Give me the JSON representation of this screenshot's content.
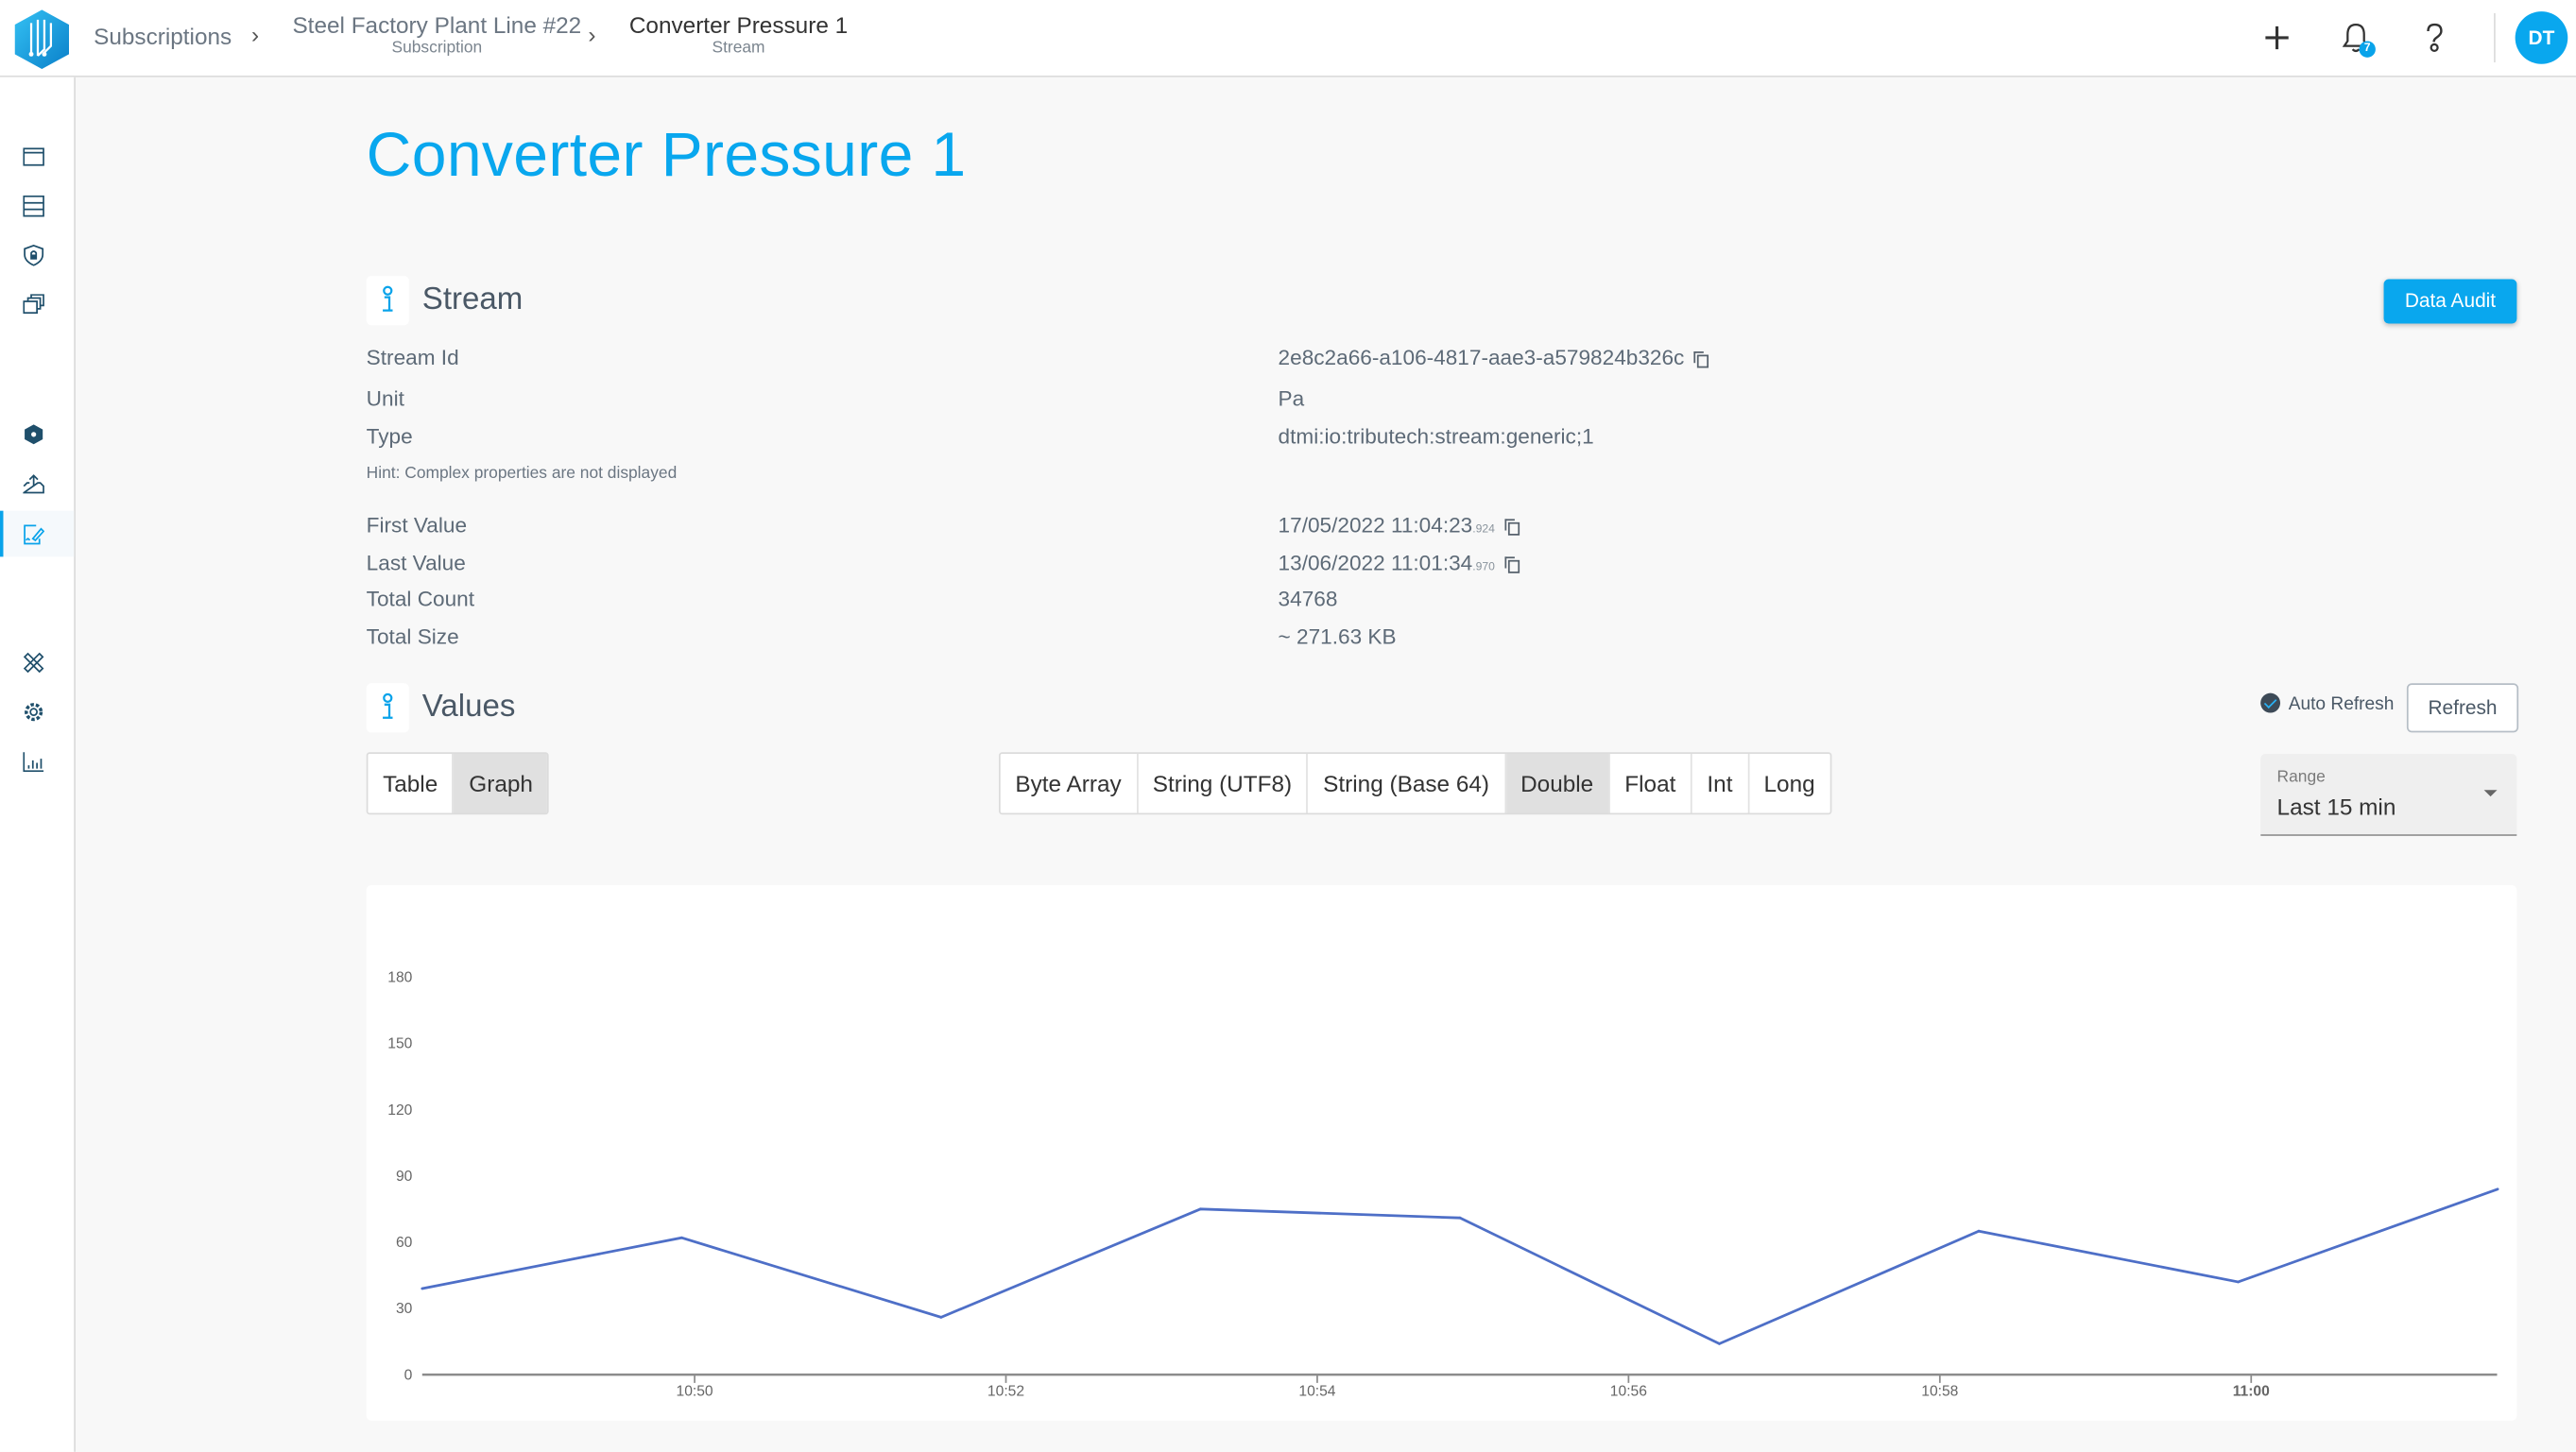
{
  "header": {
    "breadcrumbs": [
      {
        "label": "Subscriptions",
        "sub": ""
      },
      {
        "label": "Steel Factory Plant Line #22",
        "sub": "Subscription"
      },
      {
        "label": "Converter Pressure 1",
        "sub": "Stream"
      }
    ],
    "icons": [
      "plus-icon",
      "bell-icon",
      "help-icon"
    ],
    "notification_count": "7",
    "avatar_initials": "DT"
  },
  "sidebar": {
    "items": [
      {
        "icon": "browser-window-icon",
        "active": false
      },
      {
        "icon": "server-stack-icon",
        "active": false
      },
      {
        "icon": "shield-lock-icon",
        "active": false
      },
      {
        "icon": "stacked-cards-icon",
        "active": false
      },
      {
        "icon": "network-cube-icon",
        "active": false
      },
      {
        "icon": "upload-tray-icon",
        "active": false
      },
      {
        "icon": "signed-document-icon",
        "active": true
      },
      {
        "icon": "tools-icon",
        "active": false
      },
      {
        "icon": "settings-gear-icon",
        "active": false
      },
      {
        "icon": "bar-chart-icon",
        "active": false
      }
    ]
  },
  "page": {
    "title": "Converter Pressure 1",
    "accent": "#09a7ee"
  },
  "stream": {
    "heading": "Stream",
    "data_audit_label": "Data Audit",
    "props": [
      {
        "label": "Stream Id",
        "value": "2e8c2a66-a106-4817-aae3-a579824b326c"
      },
      {
        "label": "Unit",
        "value": "Pa"
      },
      {
        "label": "Type",
        "value": "dtmi:io:tributech:stream:generic;1"
      }
    ],
    "hint": "Hint: Complex properties are not displayed",
    "stats": [
      {
        "label": "First Value",
        "value": "17/05/2022 11:04:23",
        "ms": ".924"
      },
      {
        "label": "Last Value",
        "value": "13/06/2022 11:01:34",
        "ms": ".970"
      },
      {
        "label": "Total Count",
        "value": "34768"
      },
      {
        "label": "Total Size",
        "value": "~ 271.63 KB"
      }
    ]
  },
  "values": {
    "heading": "Values",
    "auto_refresh_label": "Auto Refresh",
    "auto_refresh_checked": true,
    "refresh_label": "Refresh",
    "view_tabs": [
      {
        "label": "Table",
        "selected": false
      },
      {
        "label": "Graph",
        "selected": true
      }
    ],
    "type_tabs": [
      {
        "label": "Byte Array",
        "selected": false
      },
      {
        "label": "String (UTF8)",
        "selected": false
      },
      {
        "label": "String (Base 64)",
        "selected": false
      },
      {
        "label": "Double",
        "selected": true
      },
      {
        "label": "Float",
        "selected": false
      },
      {
        "label": "Int",
        "selected": false
      },
      {
        "label": "Long",
        "selected": false
      }
    ],
    "range": {
      "label": "Range",
      "value": "Last 15 min"
    }
  },
  "chart_data": {
    "type": "line",
    "title": "",
    "xlabel": "",
    "ylabel": "",
    "x": [
      "10:48:15",
      "10:49:55",
      "10:51:35",
      "10:53:15",
      "10:54:55",
      "10:56:35",
      "10:58:15",
      "10:59:55",
      "11:01:35"
    ],
    "series": [
      {
        "name": "Double",
        "color": "#4e6fc7",
        "values": [
          39,
          62,
          26,
          75,
          71,
          14,
          65,
          42,
          84
        ]
      }
    ],
    "xticks": [
      "10:50",
      "10:52",
      "10:54",
      "10:56",
      "10:58",
      "11:00"
    ],
    "xtick_minutes": [
      650,
      652,
      654,
      656,
      658,
      660
    ],
    "yticks": [
      0,
      30,
      60,
      90,
      120,
      150,
      180
    ],
    "ylim": [
      0,
      180
    ],
    "xlim_minutes": [
      648.25,
      661.58
    ],
    "grid": false,
    "legend": "none"
  }
}
